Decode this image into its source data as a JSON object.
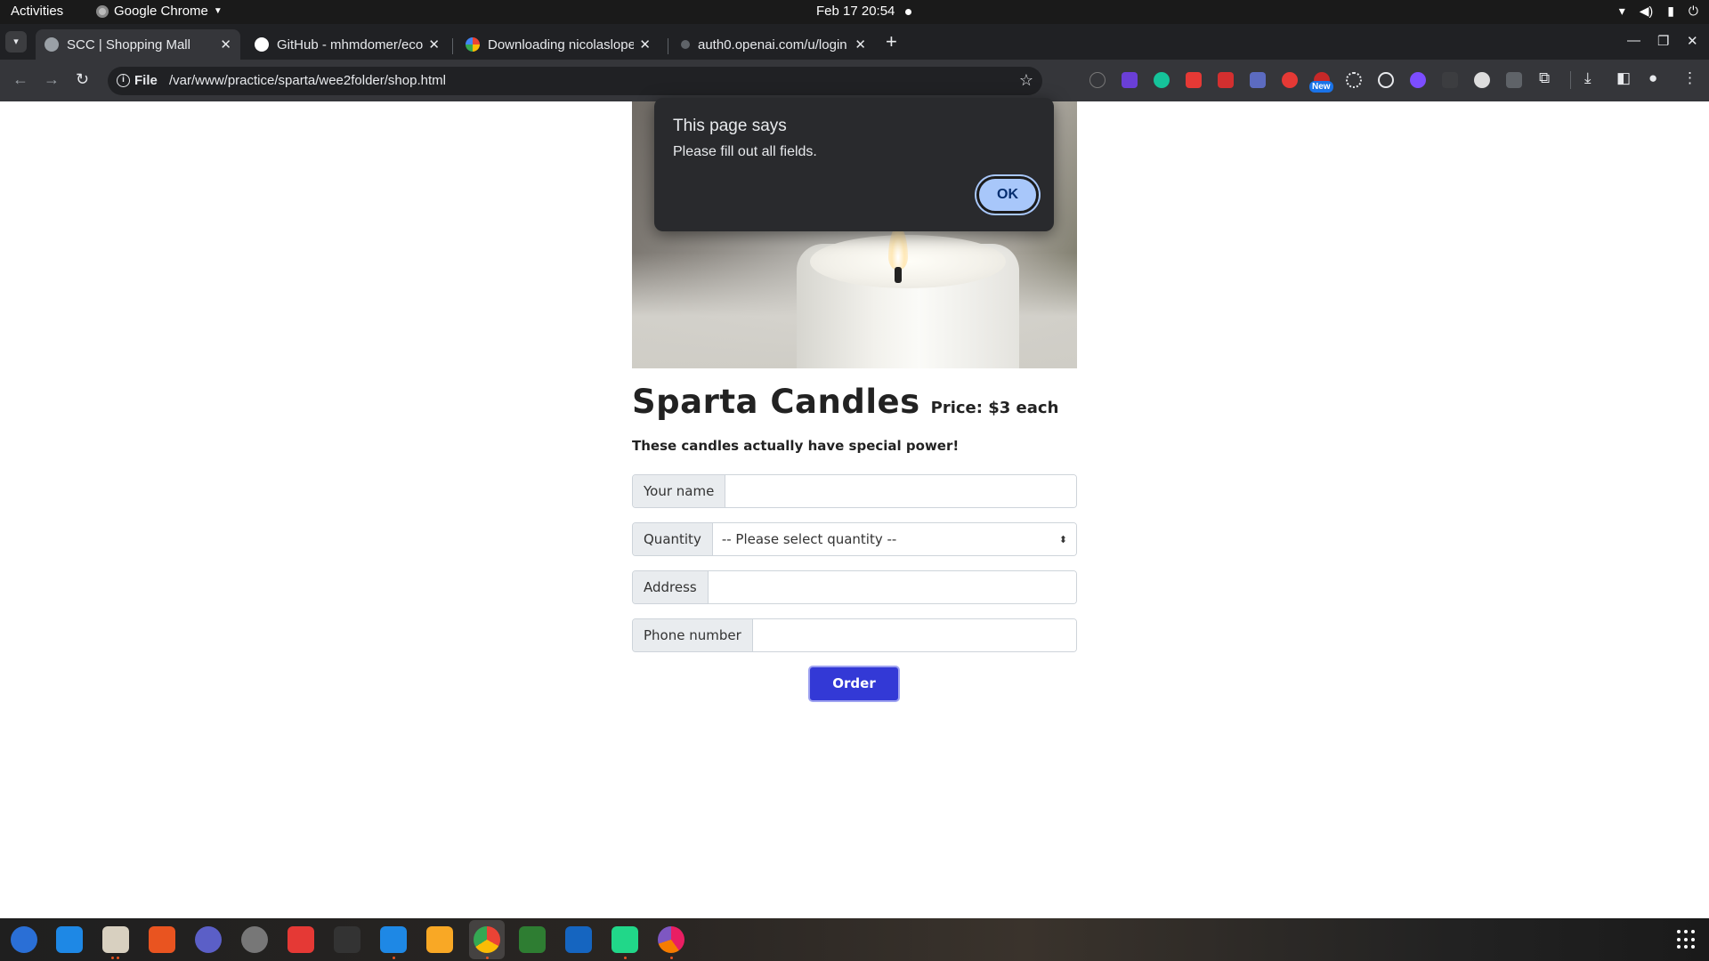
{
  "system_bar": {
    "activities": "Activities",
    "app_name": "Google Chrome",
    "clock": "Feb 17  20:54"
  },
  "browser": {
    "tabs": [
      {
        "title": "SCC | Shopping Mall",
        "active": true
      },
      {
        "title": "GitHub - mhmdomer/ecommerce",
        "active": false
      },
      {
        "title": "Downloading nicolaslopez",
        "active": false
      },
      {
        "title": "auth0.openai.com/u/login",
        "active": false
      }
    ],
    "address": {
      "scheme": "File",
      "url": "/var/www/practice/sparta/wee2folder/shop.html"
    },
    "extension_badge": "New"
  },
  "page": {
    "title": "Sparta Candles",
    "price": "Price: $3 each",
    "tagline": "These candles actually have special power!",
    "form": {
      "name_label": "Your name",
      "name_value": "",
      "quantity_label": "Quantity",
      "quantity_selected": "-- Please select quantity --",
      "address_label": "Address",
      "address_value": "",
      "phone_label": "Phone number",
      "phone_value": "",
      "order_button": "Order"
    }
  },
  "alert": {
    "title": "This page says",
    "message": "Please fill out all fields.",
    "ok": "OK"
  },
  "colors": {
    "accent_button": "#3339d6",
    "dialog_bg": "#292a2d",
    "dialog_ok": "#a8c7fa"
  }
}
